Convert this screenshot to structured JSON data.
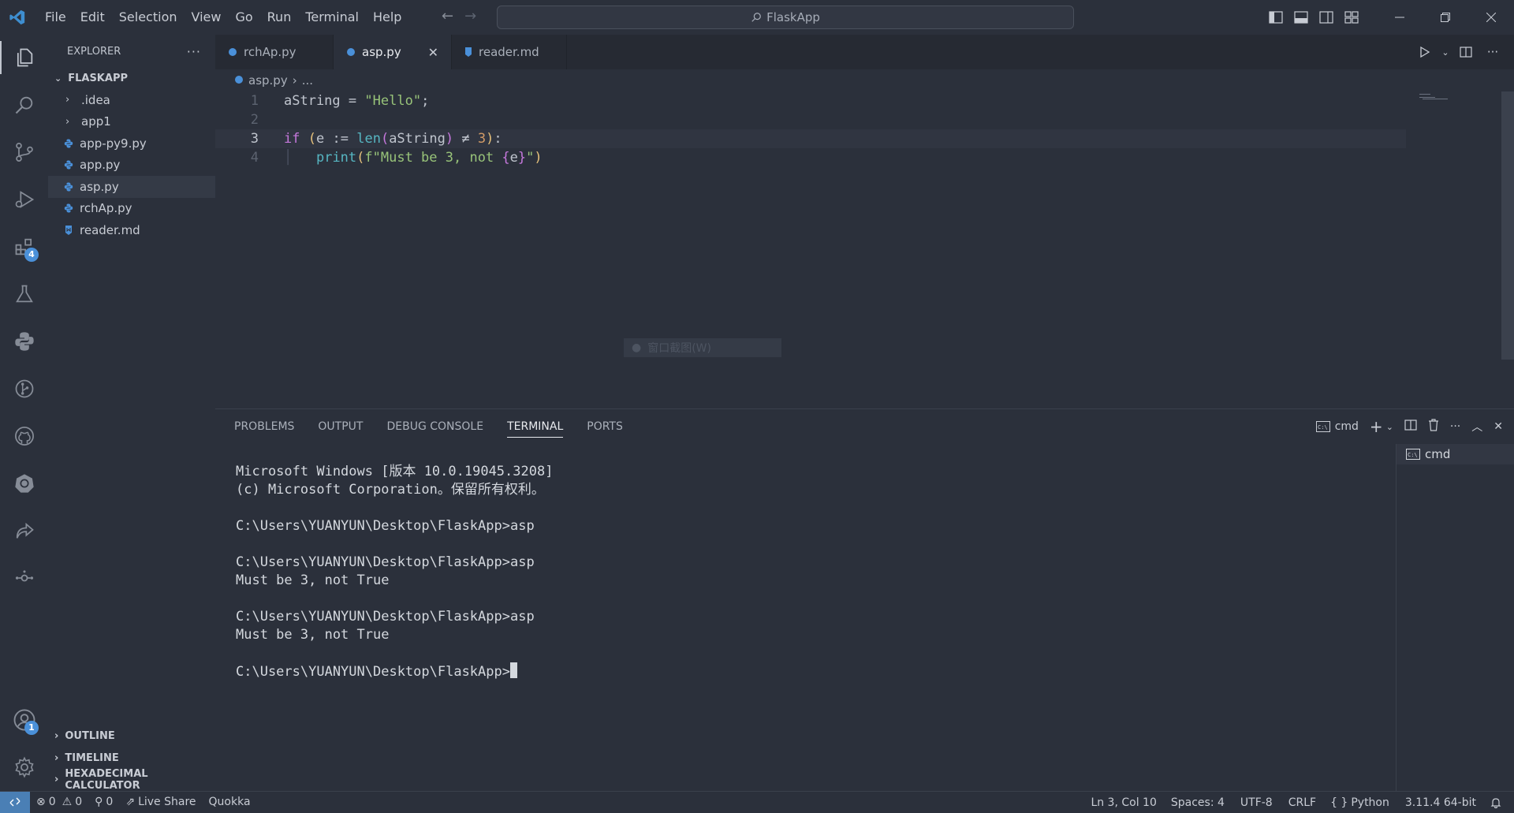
{
  "window": {
    "search_text": "FlaskApp",
    "menu": [
      "File",
      "Edit",
      "Selection",
      "View",
      "Go",
      "Run",
      "Terminal",
      "Help"
    ]
  },
  "activity": {
    "extensions_badge": "4",
    "accounts_badge": "1"
  },
  "sidebar": {
    "title": "EXPLORER",
    "root": "FLASKAPP",
    "items": [
      {
        "label": ".idea",
        "type": "folder"
      },
      {
        "label": "app1",
        "type": "folder"
      },
      {
        "label": "app-py9.py",
        "type": "python"
      },
      {
        "label": "app.py",
        "type": "python"
      },
      {
        "label": "asp.py",
        "type": "python",
        "selected": true
      },
      {
        "label": "rchAp.py",
        "type": "python"
      },
      {
        "label": "reader.md",
        "type": "markdown"
      }
    ],
    "sections": [
      "OUTLINE",
      "TIMELINE",
      "HEXADECIMAL CALCULATOR"
    ]
  },
  "tabs": [
    {
      "label": "rchAp.py"
    },
    {
      "label": "asp.py",
      "active": true
    },
    {
      "label": "reader.md"
    }
  ],
  "breadcrumb": {
    "file": "asp.py",
    "rest": "..."
  },
  "editor": {
    "line_numbers": [
      "1",
      "2",
      "3",
      "4"
    ],
    "tooltip": "窗口截图(W)"
  },
  "panel": {
    "tabs": [
      "PROBLEMS",
      "OUTPUT",
      "DEBUG CONSOLE",
      "TERMINAL",
      "PORTS"
    ],
    "active_tab": "TERMINAL",
    "shell": "cmd",
    "terminal_lines": [
      "Microsoft Windows [版本 10.0.19045.3208]",
      "(c) Microsoft Corporation。保留所有权利。",
      "",
      "C:\\Users\\YUANYUN\\Desktop\\FlaskApp>asp",
      "",
      "C:\\Users\\YUANYUN\\Desktop\\FlaskApp>asp",
      "Must be 3, not True",
      "",
      "C:\\Users\\YUANYUN\\Desktop\\FlaskApp>asp",
      "Must be 3, not True",
      ""
    ],
    "prompt": "C:\\Users\\YUANYUN\\Desktop\\FlaskApp>",
    "terminal_list_item": "cmd"
  },
  "status": {
    "errors": "0",
    "warnings": "0",
    "ports": "0",
    "live_share": "Live Share",
    "quokka": "Quokka",
    "position": "Ln 3, Col 10",
    "spaces": "Spaces: 4",
    "encoding": "UTF-8",
    "eol": "CRLF",
    "language": "Python",
    "interpreter": "3.11.4 64-bit"
  },
  "colors": {
    "background": "#2b303b",
    "accent": "#4a7fb5",
    "python_icon": "#4a90d9",
    "markdown_icon": "#4a90d9"
  }
}
